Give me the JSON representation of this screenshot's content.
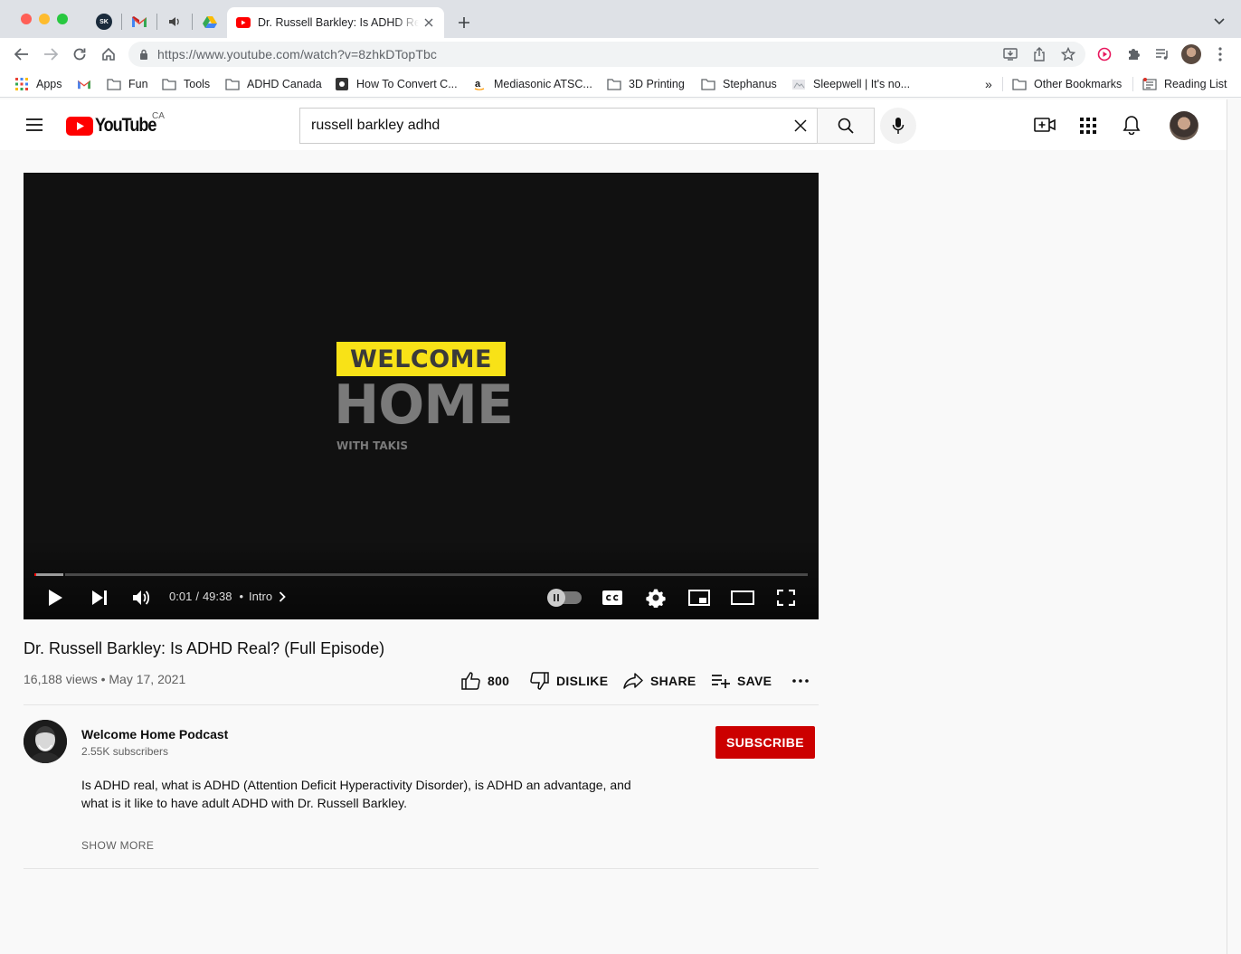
{
  "browser": {
    "active_tab_title": "Dr. Russell Barkley: Is ADHD Real? (Full Episode) - YouTube",
    "pinned_tab_1_label": "SK",
    "url_host": "https://www.youtube.com",
    "url_path": "/watch?v=8zhkDTopTbc"
  },
  "bookmarks": {
    "apps": "Apps",
    "items": [
      "Fun",
      "Tools",
      "ADHD Canada",
      "How To Convert C...",
      "Mediasonic ATSC...",
      "3D Printing",
      "Stephanus",
      "Sleepwell | It's no..."
    ],
    "overflow": "»",
    "other": "Other Bookmarks",
    "reading_list": "Reading List"
  },
  "youtube": {
    "logo_text": "YouTube",
    "region": "CA",
    "search_query": "russell barkley adhd"
  },
  "player": {
    "welcome": "WELCOME",
    "home": "HOME",
    "with": "WITH TAKIS",
    "time_current": "0:01",
    "time_sep": "/",
    "time_total": "49:38",
    "chapter_dot": "•",
    "chapter": "Intro",
    "progress_fraction": 0.002,
    "loaded_fraction": 0.038
  },
  "video": {
    "title": "Dr. Russell Barkley: Is ADHD Real? (Full Episode)",
    "stats": "16,188 views • May 17, 2021",
    "likes": "800",
    "dislike_label": "DISLIKE",
    "share_label": "SHARE",
    "save_label": "SAVE"
  },
  "channel": {
    "name": "Welcome Home Podcast",
    "subscribers": "2.55K subscribers",
    "subscribe_label": "SUBSCRIBE"
  },
  "description": {
    "text": "Is ADHD real, what is ADHD (Attention Deficit Hyperactivity Disorder), is ADHD an advantage, and what is it like to have adult ADHD with Dr. Russell Barkley.",
    "show_more": "SHOW MORE"
  },
  "colors": {
    "youtube_red": "#ff0000",
    "subscribe_red": "#cc0000",
    "logo_yellow": "#f8e217"
  }
}
